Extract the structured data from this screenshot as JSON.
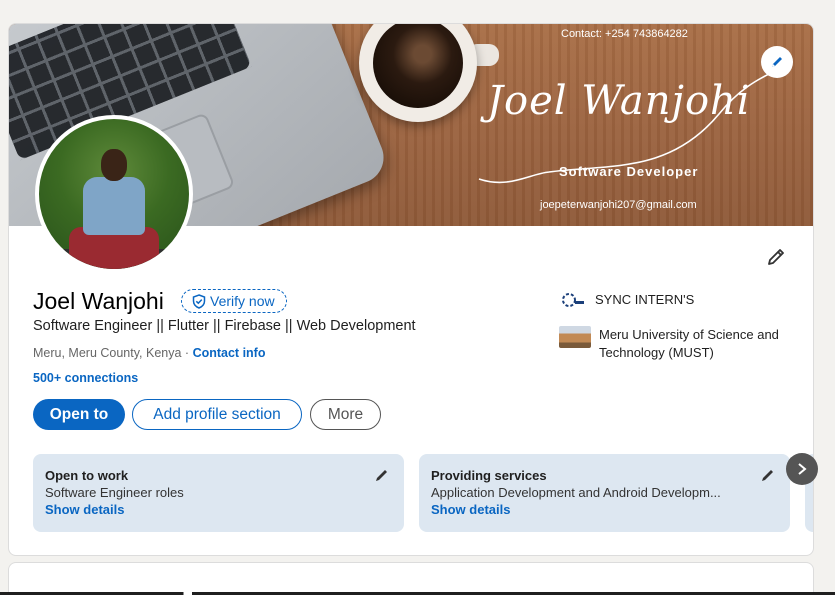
{
  "banner": {
    "contact_text": "Contact: +254 743864282",
    "script_name": "Joel Wanjohi",
    "role": "Software Developer",
    "email": "joepeterwanjohi207@gmail.com"
  },
  "profile": {
    "name": "Joel Wanjohi",
    "verify_label": "Verify now",
    "headline": "Software Engineer || Flutter || Firebase || Web Development",
    "location": "Meru, Meru County, Kenya",
    "separator": " · ",
    "contact_info_label": "Contact info",
    "connections": "500+ connections"
  },
  "actions": {
    "open_to": "Open to",
    "add_profile_section": "Add profile section",
    "more": "More"
  },
  "experience": [
    {
      "label": "SYNC INTERN'S"
    },
    {
      "label": "Meru University of Science and Technology (MUST)"
    }
  ],
  "tiles": [
    {
      "title": "Open to work",
      "subtitle": "Software Engineer roles",
      "link": "Show details"
    },
    {
      "title": "Providing services",
      "subtitle": "Application Development and Android Developm...",
      "link": "Show details"
    }
  ],
  "colors": {
    "accent": "#0a66c2",
    "tile_bg": "#dde7f1",
    "page_bg": "#f3f2ef"
  },
  "icons": [
    "pencil-icon",
    "shield-check-icon",
    "chevron-right-icon"
  ]
}
